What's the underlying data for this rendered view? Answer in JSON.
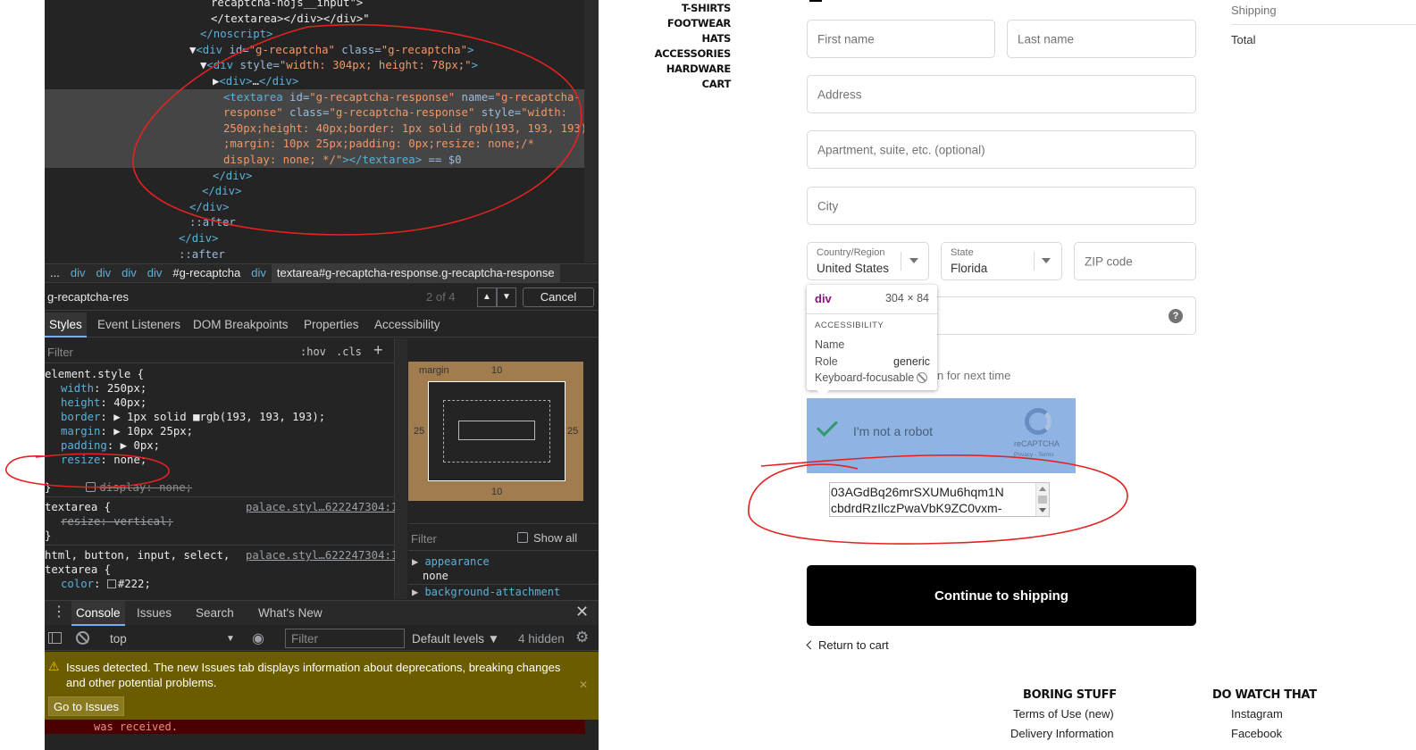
{
  "devtools": {
    "elements_lines": [
      {
        "indent": 190,
        "parts": [
          {
            "t": "recaptcha-nojs__input\">",
            "c": "txt"
          }
        ]
      },
      {
        "indent": 190,
        "parts": [
          {
            "t": "</textarea></div></div>\"",
            "c": "txt"
          }
        ]
      },
      {
        "indent": 178,
        "parts": [
          {
            "t": "</noscript>",
            "c": "tag"
          }
        ]
      },
      {
        "indent": 166,
        "parts": [
          {
            "t": "▼",
            "c": "txt"
          },
          {
            "t": "<div ",
            "c": "tag"
          },
          {
            "t": "id=",
            "c": "attr"
          },
          {
            "t": "\"g-recaptcha\"",
            "c": "val"
          },
          {
            "t": " class=",
            "c": "attr"
          },
          {
            "t": "\"g-recaptcha\"",
            "c": "val"
          },
          {
            "t": ">",
            "c": "tag"
          }
        ]
      },
      {
        "indent": 178,
        "parts": [
          {
            "t": "▼",
            "c": "txt"
          },
          {
            "t": "<div ",
            "c": "tag"
          },
          {
            "t": "style=",
            "c": "attr"
          },
          {
            "t": "\"width: 304px; height: 78px;\"",
            "c": "val"
          },
          {
            "t": ">",
            "c": "tag"
          }
        ]
      },
      {
        "indent": 192,
        "parts": [
          {
            "t": "▶",
            "c": "txt"
          },
          {
            "t": "<div>",
            "c": "tag"
          },
          {
            "t": "…",
            "c": "txt"
          },
          {
            "t": "</div>",
            "c": "tag"
          }
        ]
      },
      {
        "indent": 204,
        "selected": true,
        "parts": [
          {
            "t": "<textarea ",
            "c": "tag"
          },
          {
            "t": "id=",
            "c": "attr"
          },
          {
            "t": "\"g-recaptcha-response\"",
            "c": "val"
          },
          {
            "t": " name=",
            "c": "attr"
          },
          {
            "t": "\"g-recaptcha-",
            "c": "val"
          }
        ]
      },
      {
        "indent": 204,
        "selected": true,
        "parts": [
          {
            "t": "response\"",
            "c": "val"
          },
          {
            "t": " class=",
            "c": "attr"
          },
          {
            "t": "\"g-recaptcha-response\"",
            "c": "val"
          },
          {
            "t": " style=",
            "c": "attr"
          },
          {
            "t": "\"width:",
            "c": "val"
          }
        ]
      },
      {
        "indent": 204,
        "selected": true,
        "parts": [
          {
            "t": "250px;height: 40px;border: 1px solid rgb(193, 193, 193)",
            "c": "val"
          }
        ]
      },
      {
        "indent": 204,
        "selected": true,
        "parts": [
          {
            "t": ";margin: 10px 25px;padding: 0px;resize: none;/*",
            "c": "val"
          }
        ]
      },
      {
        "indent": 204,
        "selected": true,
        "parts": [
          {
            "t": "display: none; */\"",
            "c": "val"
          },
          {
            "t": "></textarea>",
            "c": "tag"
          },
          {
            "t": " == $0",
            "c": "attr"
          }
        ]
      },
      {
        "indent": 192,
        "parts": [
          {
            "t": "</div>",
            "c": "tag"
          }
        ]
      },
      {
        "indent": 180,
        "parts": [
          {
            "t": "</div>",
            "c": "tag"
          }
        ]
      },
      {
        "indent": 166,
        "parts": [
          {
            "t": "</div>",
            "c": "tag"
          }
        ]
      },
      {
        "indent": 166,
        "parts": [
          {
            "t": "::after",
            "c": "attr"
          }
        ]
      },
      {
        "indent": 154,
        "parts": [
          {
            "t": "</div>",
            "c": "tag"
          }
        ]
      },
      {
        "indent": 154,
        "parts": [
          {
            "t": "::after",
            "c": "attr"
          }
        ]
      }
    ],
    "breadcrumbs": [
      "...",
      "div",
      "div",
      "div",
      "div",
      "#g-recaptcha",
      "div",
      "textarea#g-recaptcha-response.g-recaptcha-response"
    ],
    "search": {
      "value": "g-recaptcha-res",
      "count": "2 of 4",
      "cancel": "Cancel",
      "up": "▲",
      "down": "▼"
    },
    "panel_tabs": [
      "Styles",
      "Event Listeners",
      "DOM Breakpoints",
      "Properties",
      "Accessibility"
    ],
    "styles_filter": {
      "placeholder": "Filter",
      "hov": ":hov",
      "cls": ".cls",
      "plus": "+"
    },
    "element_style": {
      "selector": "element.style {",
      "props": [
        {
          "name": "width",
          "value": "250px;"
        },
        {
          "name": "height",
          "value": "40px;"
        },
        {
          "name": "border",
          "value": "▶ 1px solid ■rgb(193, 193, 193);"
        },
        {
          "name": "margin",
          "value": "▶ 10px 25px;"
        },
        {
          "name": "padding",
          "value": "▶ 0px;"
        },
        {
          "name": "resize",
          "value": "none;"
        },
        {
          "name": "display",
          "value": "none;",
          "disabled": true
        }
      ],
      "close": "}"
    },
    "rule_textarea": {
      "selector": "textarea {",
      "source": "palace.styl…622247304:1",
      "prop": "resize: vertical;",
      "close": "}"
    },
    "rule_html": {
      "selector1": "html, button, input, select,",
      "selector2": "textarea {",
      "source": "palace.styl…622247304:1",
      "prop_name": "color",
      "prop_value": "#222;"
    },
    "box_model": {
      "margin_label": "margin",
      "top": "10",
      "bottom": "10",
      "left": "25",
      "right": "25"
    },
    "computed": {
      "filter": "Filter",
      "show_all": "Show all",
      "prop1": "appearance",
      "val1": "none",
      "prop2": "background-attachment"
    },
    "console_tabs": [
      "Console",
      "Issues",
      "Search",
      "What's New"
    ],
    "console_toolbar": {
      "context": "top",
      "filter": "Filter",
      "levels": "Default levels ▼",
      "hidden": "4 hidden"
    },
    "issues": {
      "text": "Issues detected. The new Issues tab displays information about deprecations, breaking changes and other potential problems.",
      "button": "Go to Issues"
    },
    "error_line": "was received."
  },
  "store": {
    "nav": [
      "T-SHIRTS",
      "FOOTWEAR",
      "HATS",
      "ACCESSORIES",
      "HARDWARE",
      "CART"
    ],
    "fields": {
      "first_name": "First name",
      "last_name": "Last name",
      "address": "Address",
      "apartment": "Apartment, suite, etc. (optional)",
      "city": "City",
      "country_label": "Country/Region",
      "country_value": "United States",
      "state_label": "State",
      "state_value": "Florida",
      "zip": "ZIP code"
    },
    "save_info_partial": "n for next time",
    "tooltip": {
      "tag": "div",
      "size": "304 × 84",
      "section": "ACCESSIBILITY",
      "name_label": "Name",
      "role_label": "Role",
      "role_value": "generic",
      "focus_label": "Keyboard-focusable"
    },
    "recaptcha": {
      "label": "I'm not a robot",
      "brand": "reCAPTCHA",
      "links": "Privacy - Terms"
    },
    "token_text": {
      "line1": "03AGdBq26mrSXUMu6hqm1N",
      "line2": "cbdrdRzIlczPwaVbK9ZC0vxm-"
    },
    "continue_label": "Continue to shipping",
    "return_label": "Return to cart",
    "summary": {
      "shipping": "Shipping",
      "total": "Total"
    },
    "footer": {
      "col1_head": "BORING STUFF",
      "col1_links": [
        "Terms of Use (new)",
        "Delivery Information"
      ],
      "col2_head": "DO WATCH THAT",
      "col2_links": [
        "Instagram",
        "Facebook"
      ]
    }
  },
  "colors": {
    "annotation": "#e32222",
    "devtools_bg": "#242424",
    "recaptcha_overlay": "#8fb4e3"
  }
}
